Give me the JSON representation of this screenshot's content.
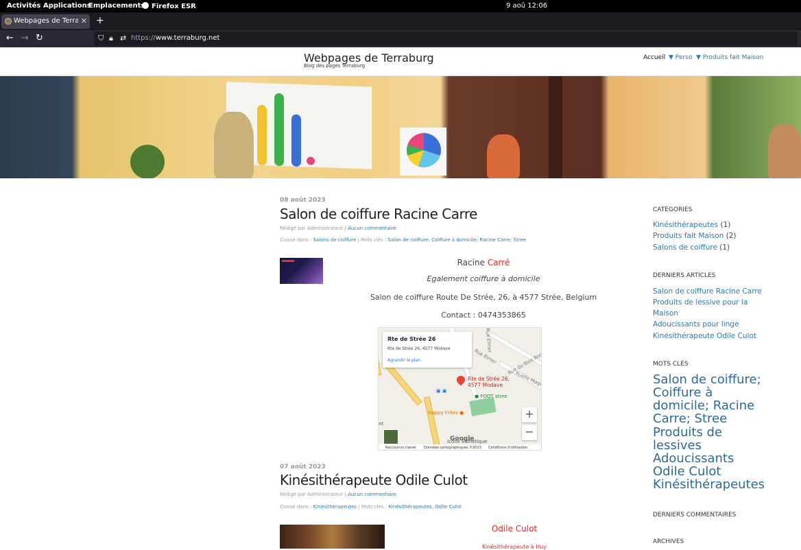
{
  "system_bar": {
    "activities": "Activités",
    "applications": "Applications",
    "places": "Emplacements",
    "app_name": "Firefox ESR",
    "clock": "9 aoû  12:06"
  },
  "browser": {
    "tab_title": "Webpages de Terraburg",
    "tab_close": "✕",
    "new_tab": "+",
    "back": "←",
    "forward": "→",
    "reload": "↻",
    "url_scheme": "https://",
    "url_host": "www.terraburg.net"
  },
  "site": {
    "title": "Webpages de Terraburg",
    "tagline": "Blog des pages Terraburg",
    "menu": [
      "Accueil",
      "▼ Perso",
      "▼ Produits fait Maison"
    ]
  },
  "posts": [
    {
      "date": "08 août 2023",
      "title": "Salon de coiffure Racine Carre",
      "byline_prefix": "Rédigé par Administrateur |",
      "comments": "Aucun commentaire",
      "filed_prefix": "Classé dans :",
      "category": "Salons de coiffure",
      "tags_prefix": "| Mots clés :",
      "tags": "Salon de coiffure; Coiffure à domicile; Racine Carre; Stree",
      "name_black": "Racine",
      "name_red": "Carré",
      "subtitle": "Egalement coiffure à domicile",
      "address": "Salon de coiffure Route De Strée, 26,  à 4577 Strée, Belgium",
      "contact": "Contact : 0474353865"
    },
    {
      "date": "07 août 2023",
      "title": "Kinésithérapeute Odile Culot",
      "byline_prefix": "Rédigé par Administrateur |",
      "comments": "Aucun commentaire",
      "filed_prefix": "Classé dans :",
      "category": "Kinésithérapeutes",
      "tags_prefix": "| Mots clés :",
      "tags": "Kinésithérapeutes, Odile Culot",
      "name_red": "Odile Culot",
      "subtitle_red": "Kinésithérapeute à Huy"
    }
  ],
  "map": {
    "info_title": "Rte de Strée 26",
    "info_address": "Rte de Strée 26, 4577 Modave",
    "info_link": "Agrandir le plan",
    "pin_label_1": "Rte de Strée 26,",
    "pin_label_2": "4577 Modave",
    "poi_foot": "FOOT stree",
    "poi_frites": "Happy Frites",
    "poi_icone": "Icône Esthétique",
    "street_elmer": "Rue Elmer",
    "street_bois": "Rue du Bois Rosine",
    "street_magne": "Ruelle Magne",
    "street_top": "Rue Elmer",
    "edge_label": "nt",
    "zoom_in": "+",
    "zoom_out": "−",
    "google": "Google",
    "footer_shortcuts": "Raccourcis clavier",
    "footer_data": "Données cartographiques ©2023",
    "footer_terms": "Conditions d'utilisation"
  },
  "sidebar": {
    "categories_title": "CATÉGORIES",
    "categories": [
      {
        "label": "Kinésithérapeutes",
        "count": "(1)"
      },
      {
        "label": "Produits fait Maison",
        "count": "(2)"
      },
      {
        "label": "Salons de coiffure",
        "count": "(1)"
      }
    ],
    "recent_title": "DERNIERS ARTICLES",
    "recent": [
      "Salon de coiffure Racine Carre",
      "Produits de lessive pour la",
      "Maison",
      "Adoucissants pour linge",
      "Kinésithérapeute Odile Culot"
    ],
    "tags_title": "MOTS CLÉS",
    "tags": [
      "Salon de coiffure;",
      "Coiffure à",
      "domicile; Racine",
      "Carre; Stree",
      "Produits de",
      "lessives",
      "Adoucissants",
      "Odile Culot",
      "Kinésithérapeutes"
    ],
    "comments_title": "DERNIERS COMMENTAIRES",
    "archives_title": "ARCHIVES"
  }
}
